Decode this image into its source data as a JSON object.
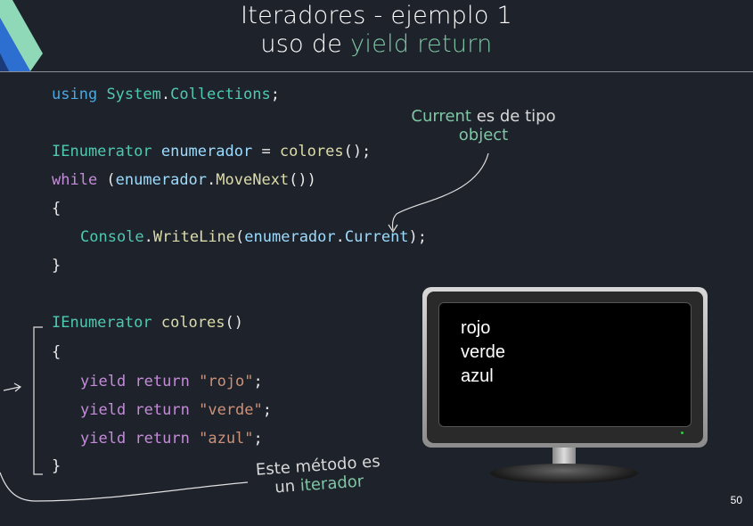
{
  "title": {
    "line1": "Iteradores - ejemplo 1",
    "line2_prefix": "uso de ",
    "line2_accent": "yield return"
  },
  "code": {
    "l1": {
      "kw": "using",
      "ns1": "System",
      "dot": ".",
      "ns2": "Collections",
      "end": ";"
    },
    "l2": {
      "type": "IEnumerator",
      "var": "enumerador",
      "op": " = ",
      "fn": "colores",
      "end": "();"
    },
    "l3": {
      "kw": "while",
      "open": " (",
      "var": "enumerador",
      "dot": ".",
      "fn": "MoveNext",
      "end": "())"
    },
    "l4": "{",
    "l5": {
      "type": "Console",
      "dot": ".",
      "fn": "WriteLine",
      "open": "(",
      "var": "enumerador",
      "dot2": ".",
      "prop": "Current",
      "end": ");"
    },
    "l6": "}",
    "l7": {
      "type": "IEnumerator",
      "fn": "colores",
      "end": "()"
    },
    "l8": "{",
    "yields": [
      {
        "kw1": "yield",
        "kw2": "return",
        "str": "\"rojo\"",
        "end": ";"
      },
      {
        "kw1": "yield",
        "kw2": "return",
        "str": "\"verde\"",
        "end": ";"
      },
      {
        "kw1": "yield",
        "kw2": "return",
        "str": "\"azul\"",
        "end": ";"
      }
    ],
    "l12": "}"
  },
  "note_current": {
    "accent1": "Current",
    "text1": " es de tipo",
    "accent2": "object"
  },
  "note_iterator": {
    "line1": "Este método es",
    "prefix2": "un ",
    "accent2": "iterador"
  },
  "console_output": [
    "rojo",
    "verde",
    "azul"
  ],
  "page_number": "50",
  "colors": {
    "background": "#1e222b",
    "accent": "#7fc6a4",
    "keyword": "#c48bd9",
    "type": "#4ec9b0",
    "function": "#dcdcaa",
    "string": "#ce9178"
  }
}
